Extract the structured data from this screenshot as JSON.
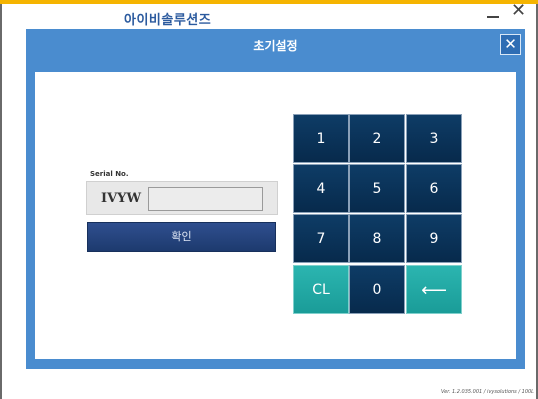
{
  "app": {
    "title": "아이비솔루션즈",
    "close_glyph": "✕"
  },
  "dialog": {
    "title": "초기설정",
    "close_glyph": "✕"
  },
  "serial": {
    "label": "Serial No.",
    "prefix": "IVYW",
    "value": "",
    "confirm_label": "확인"
  },
  "keypad": {
    "keys": [
      {
        "label": "1",
        "variant": "dark"
      },
      {
        "label": "2",
        "variant": "dark"
      },
      {
        "label": "3",
        "variant": "dark"
      },
      {
        "label": "4",
        "variant": "dark"
      },
      {
        "label": "5",
        "variant": "dark"
      },
      {
        "label": "6",
        "variant": "dark"
      },
      {
        "label": "7",
        "variant": "dark"
      },
      {
        "label": "8",
        "variant": "dark"
      },
      {
        "label": "9",
        "variant": "dark"
      },
      {
        "label": "CL",
        "variant": "teal",
        "icon": "clear"
      },
      {
        "label": "0",
        "variant": "dark"
      },
      {
        "label": "⟵",
        "variant": "teal",
        "icon": "backspace-arrow-icon"
      }
    ]
  },
  "footer": {
    "version": "Ver. 1.2.035.001 / ivysolutions / 100L"
  },
  "colors": {
    "accent_bar": "#f5b400",
    "dialog_blue": "#4a8ccf",
    "key_dark": "#0e3c66",
    "key_teal": "#2bb5b0",
    "confirm_button": "#2f4f8f"
  }
}
